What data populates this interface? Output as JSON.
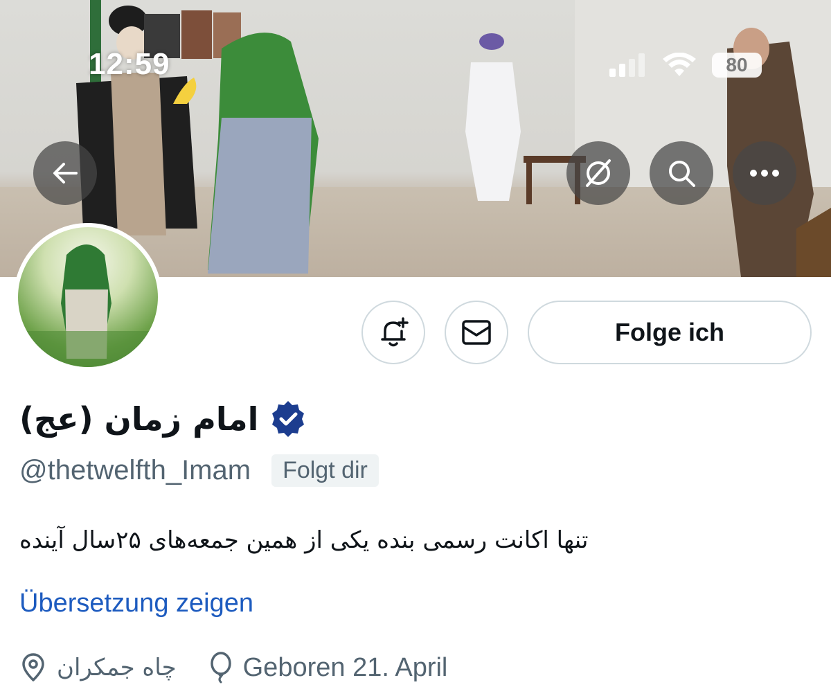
{
  "status_bar": {
    "time": "12:59",
    "battery": "80"
  },
  "profile": {
    "display_name": "امام زمان (عج)",
    "handle": "@thetwelfth_Imam",
    "follows_you_badge": "Folgt dir",
    "bio": "تنها اکانت رسمی بنده یکی از همین جمعه‌های ۲۵سال آینده",
    "translate_link": "Übersetzung zeigen",
    "location": "چاه جمکران",
    "birthday": "Geboren 21. April"
  },
  "actions": {
    "follow_label": "Folge ich"
  },
  "icons": {
    "back": "arrow-left-icon",
    "grok": "grok-icon",
    "search": "search-icon",
    "more": "more-icon",
    "notify": "bell-plus-icon",
    "message": "envelope-icon",
    "location": "location-pin-icon",
    "birthday": "balloon-icon",
    "verified": "verified-badge-icon"
  },
  "colors": {
    "verified_badge": "#1c3d8f",
    "link": "#1d5bbf",
    "secondary_text": "#536471",
    "border": "#cfd9de"
  }
}
